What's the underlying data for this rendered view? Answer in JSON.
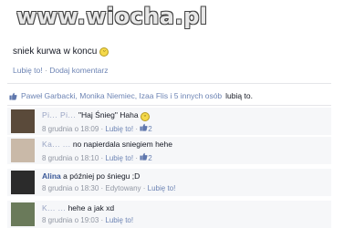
{
  "watermark": "www.wiocha.pl",
  "post": {
    "text": "sniek kurwa w koncu",
    "actions": [
      "Lubię to!",
      "Dodaj komentarz"
    ],
    "separator": "·"
  },
  "likes_summary": {
    "names": "Paweł Garbacki, Monika Niemiec, Izaa Flis i 5 innych osób",
    "suffix": "lubią to."
  },
  "comments": [
    {
      "name": "Pi... Pi... ",
      "text": "\"Haj Śnieg\" Haha",
      "date": "8 grudnia o 18:09",
      "action": "Lubię to!",
      "likes": "2",
      "edited": ""
    },
    {
      "name": "Ka... ...",
      "text": "no napierdala sniegiem hehe",
      "date": "8 grudnia o 18:10",
      "action": "Lubię to!",
      "likes": "2",
      "edited": ""
    },
    {
      "name": "Alina",
      "text": "a później po śniegu ;D",
      "date": "8 grudnia o 18:30",
      "action": "Lubię to!",
      "likes": "",
      "edited": "Edytowany"
    },
    {
      "name": "K... ...",
      "text": "hehe a jak xd",
      "date": "8 grudnia o 19:03",
      "action": "Lubię to!",
      "likes": "",
      "edited": ""
    }
  ]
}
